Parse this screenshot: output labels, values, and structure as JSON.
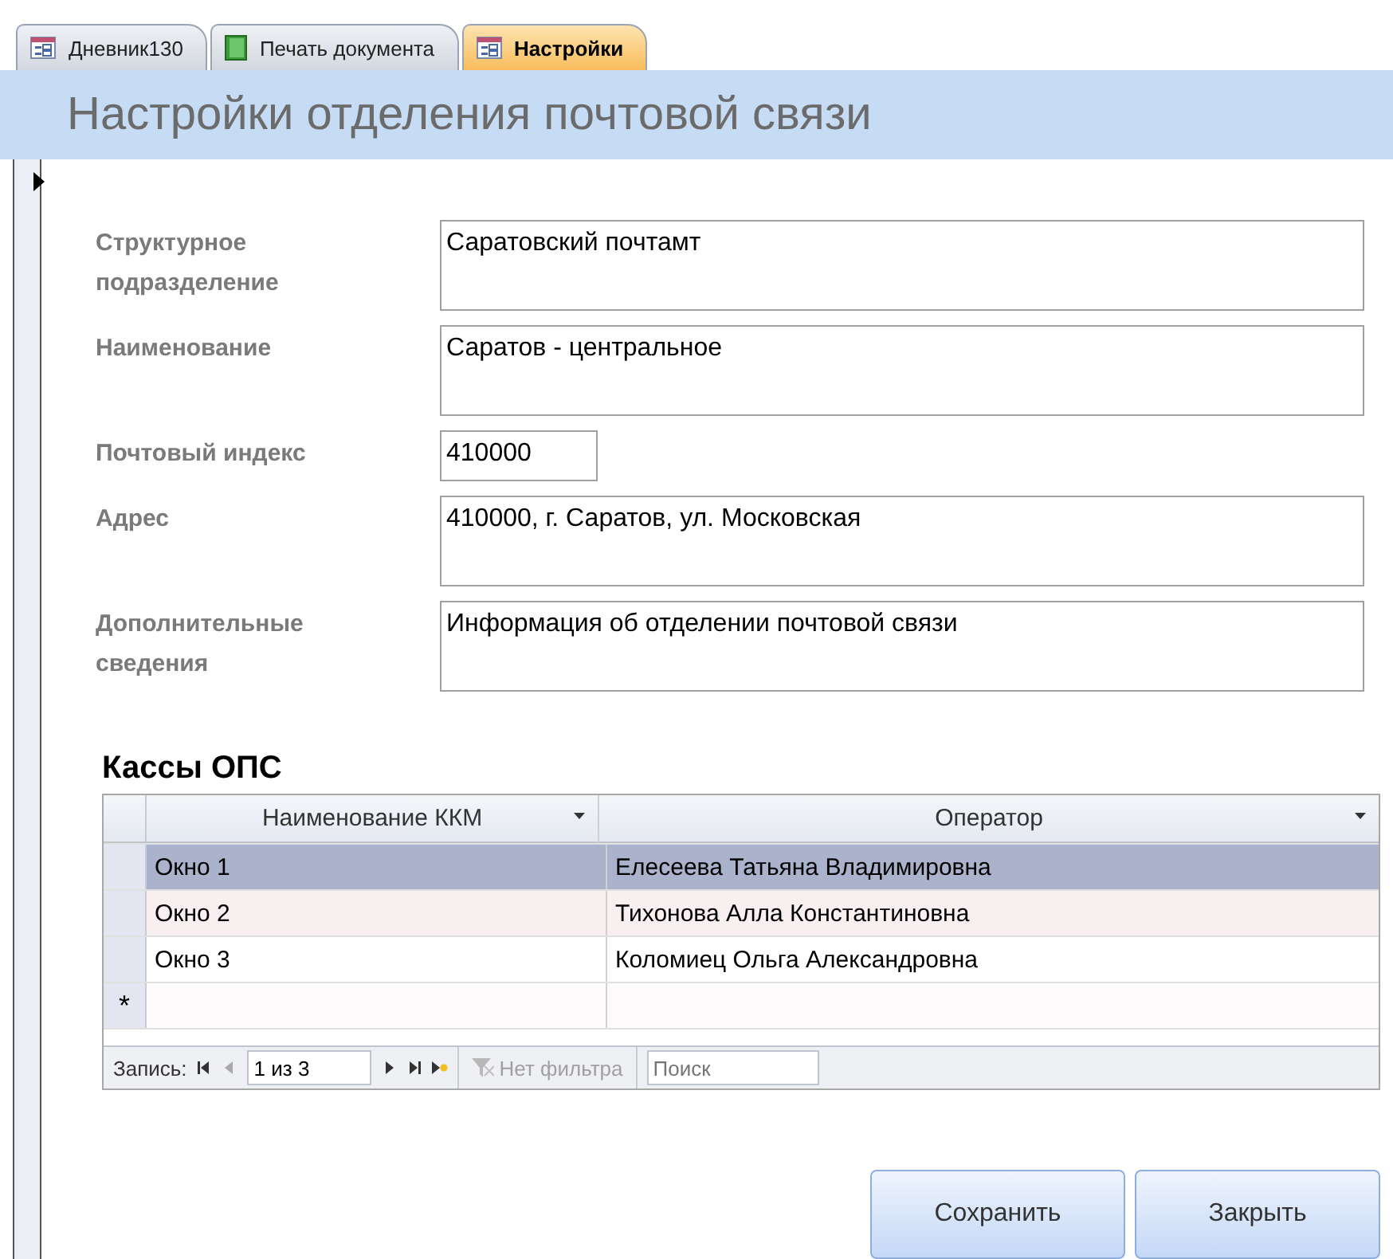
{
  "tabs": [
    {
      "label": "Дневник130",
      "kind": "form",
      "selected": false
    },
    {
      "label": "Печать документа",
      "kind": "report",
      "selected": false
    },
    {
      "label": "Настройки",
      "kind": "form",
      "selected": true
    }
  ],
  "form": {
    "title": "Настройки отделения почтовой связи",
    "fields": [
      {
        "label": "Структурное подразделение",
        "value": "Саратовский почтамт",
        "kind": "memo"
      },
      {
        "label": "Наименование",
        "value": "Саратов - центральное",
        "kind": "memo"
      },
      {
        "label": "Почтовый индекс",
        "value": "410000",
        "kind": "short"
      },
      {
        "label": "Адрес",
        "value": "410000, г. Саратов, ул. Московская",
        "kind": "memo"
      },
      {
        "label": "Дополнительные сведения",
        "value": "Информация об отделении почтовой связи",
        "kind": "memo"
      }
    ],
    "subform_title": "Кассы ОПС",
    "table": {
      "columns": [
        "Наименование ККМ",
        "Оператор"
      ],
      "rows": [
        {
          "cells": [
            "Окно 1",
            "Елесеева Татьяна Владимировна"
          ],
          "selected": true
        },
        {
          "cells": [
            "Окно 2",
            "Тихонова Алла Константиновна"
          ],
          "selected": false
        },
        {
          "cells": [
            "Окно 3",
            "Коломиец Ольга Александровна"
          ],
          "selected": false
        }
      ],
      "new_row_marker": "*",
      "navigation": {
        "label": "Запись:",
        "position": "1 из 3",
        "filter": "Нет фильтра",
        "search_placeholder": "Поиск"
      }
    },
    "buttons": [
      "Сохранить",
      "Закрыть"
    ]
  }
}
